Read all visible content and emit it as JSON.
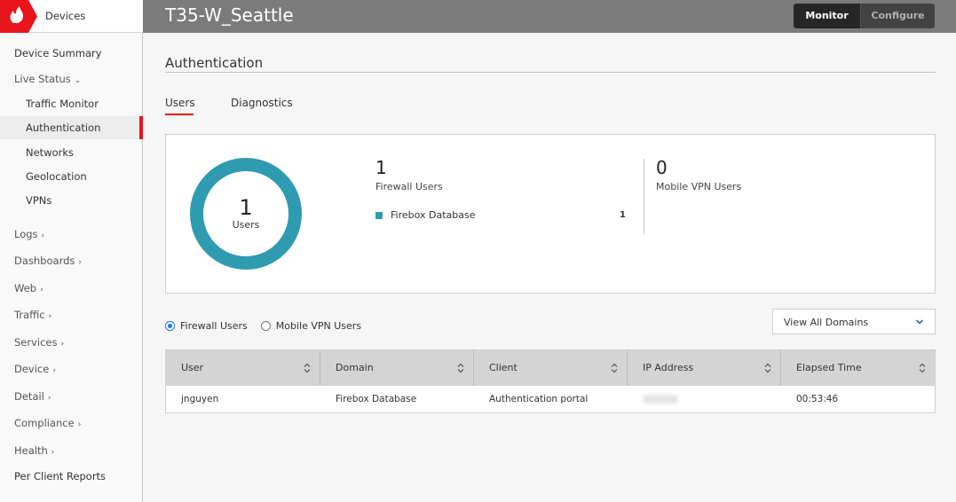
{
  "brand": {
    "section": "Devices",
    "logo_icon": "firebox-flame-icon",
    "accent_color": "#e8141b"
  },
  "header": {
    "device_name": "T35-W_Seattle",
    "modes": [
      {
        "label": "Monitor",
        "active": true
      },
      {
        "label": "Configure",
        "active": false
      }
    ]
  },
  "sidebar": {
    "items": [
      {
        "label": "Device Summary",
        "level": "top"
      },
      {
        "label": "Live Status",
        "level": "top",
        "chevron": "down"
      },
      {
        "label": "Traffic Monitor",
        "level": "sub"
      },
      {
        "label": "Authentication",
        "level": "sub",
        "active": true
      },
      {
        "label": "Networks",
        "level": "sub"
      },
      {
        "label": "Geolocation",
        "level": "sub"
      },
      {
        "label": "VPNs",
        "level": "sub"
      },
      {
        "label": "Logs",
        "level": "top",
        "chevron": "right"
      },
      {
        "label": "Dashboards",
        "level": "top",
        "chevron": "right"
      },
      {
        "label": "Web",
        "level": "top",
        "chevron": "right"
      },
      {
        "label": "Traffic",
        "level": "top",
        "chevron": "right"
      },
      {
        "label": "Services",
        "level": "top",
        "chevron": "right"
      },
      {
        "label": "Device",
        "level": "top",
        "chevron": "right"
      },
      {
        "label": "Detail",
        "level": "top",
        "chevron": "right"
      },
      {
        "label": "Compliance",
        "level": "top",
        "chevron": "right"
      },
      {
        "label": "Health",
        "level": "top",
        "chevron": "right"
      },
      {
        "label": "Per Client Reports",
        "level": "top"
      }
    ]
  },
  "main": {
    "page_title": "Authentication",
    "tabs": [
      {
        "label": "Users",
        "active": true
      },
      {
        "label": "Diagnostics",
        "active": false
      }
    ],
    "summary": {
      "total_users": "1",
      "total_users_label": "Users",
      "donut_color": "#2f9bb0",
      "firewall_users": "1",
      "firewall_users_label": "Firewall Users",
      "legend": [
        {
          "label": "Firebox Database",
          "count": "1",
          "color": "#2f9bb0"
        }
      ],
      "mobile_vpn_users": "0",
      "mobile_vpn_users_label": "Mobile VPN Users"
    },
    "filter": {
      "radios": [
        {
          "label": "Firewall Users",
          "checked": true
        },
        {
          "label": "Mobile VPN Users",
          "checked": false
        }
      ],
      "domain_select": "View All Domains"
    },
    "table": {
      "columns": [
        "User",
        "Domain",
        "Client",
        "IP Address",
        "Elapsed Time"
      ],
      "rows": [
        {
          "user": "jnguyen",
          "domain": "Firebox Database",
          "client": "Authentication portal",
          "ip": "(redacted)",
          "elapsed": "00:53:46"
        }
      ]
    }
  }
}
